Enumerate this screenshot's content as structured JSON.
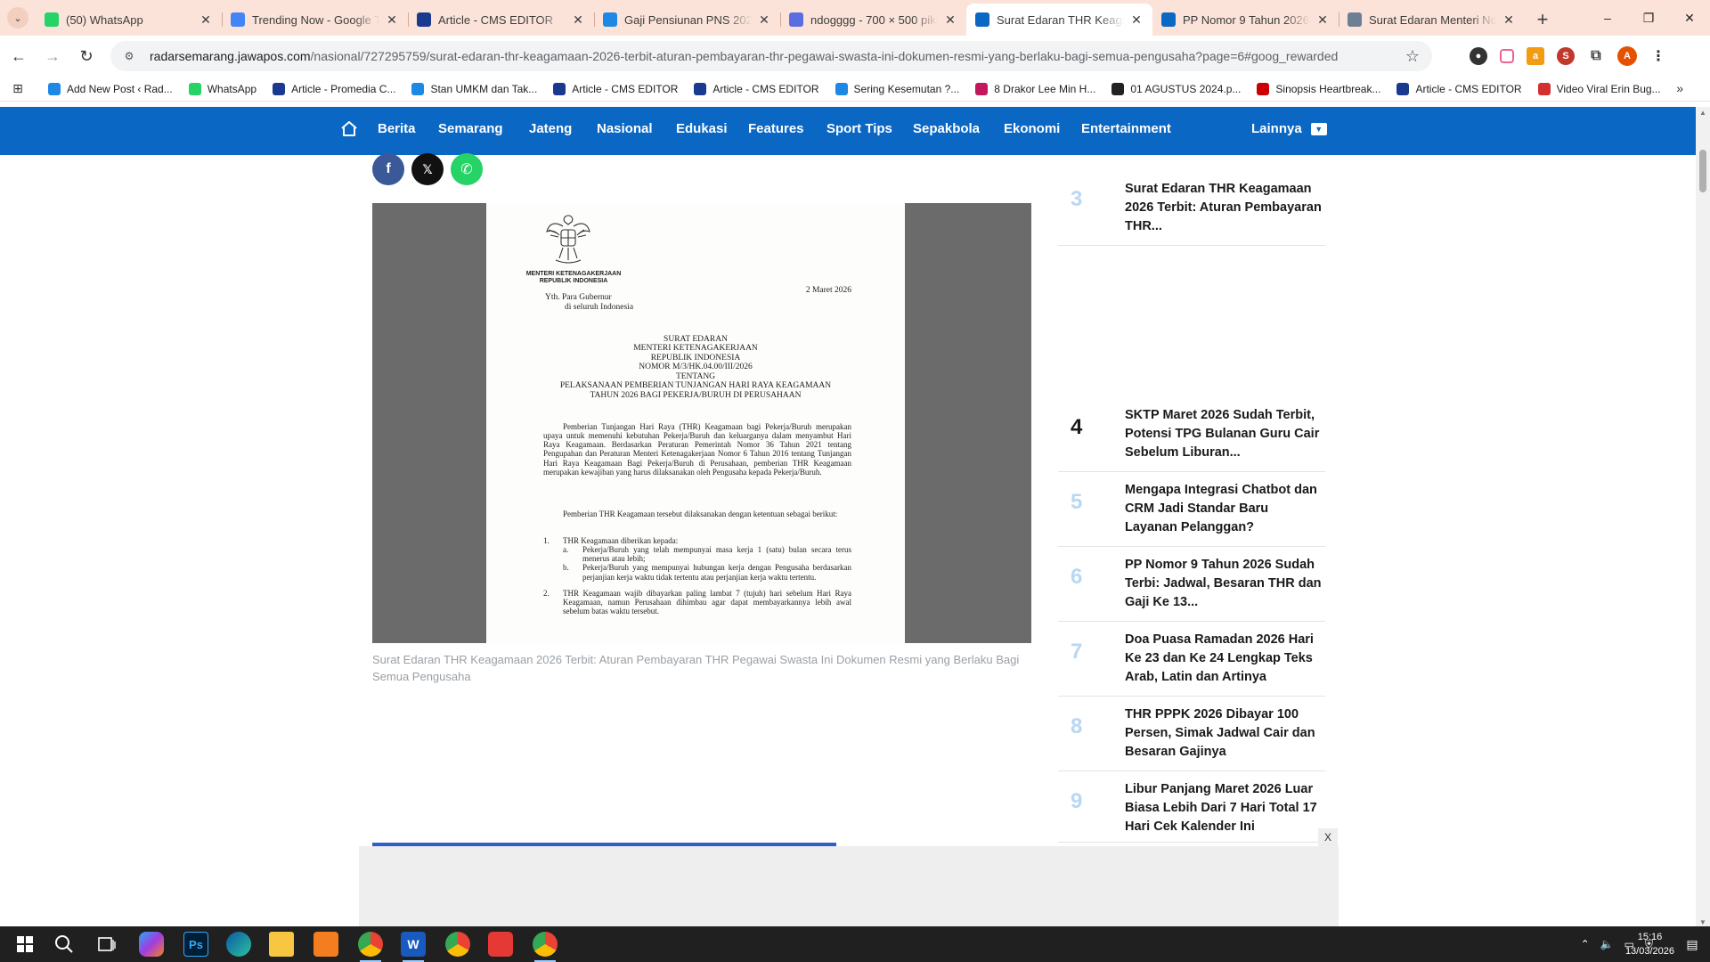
{
  "browser": {
    "tabs": [
      {
        "title": "(50) WhatsApp",
        "favicon": "whatsapp-icon",
        "color": "#25d366",
        "active": false
      },
      {
        "title": "Trending Now - Google Trends",
        "favicon": "google-trends-icon",
        "color": "#4285f4",
        "active": false
      },
      {
        "title": "Article - CMS EDITOR",
        "favicon": "cms-editor-icon",
        "color": "#1a3a8f",
        "active": false
      },
      {
        "title": "Gaji Pensiunan PNS 2026",
        "favicon": "bookmark-doc-icon",
        "color": "#1e88e5",
        "active": false
      },
      {
        "title": "ndogggg - 700 × 500 piksel",
        "favicon": "canva-icon",
        "color": "#5b6ee1",
        "active": false
      },
      {
        "title": "Surat Edaran THR Keagamaan",
        "favicon": "radar-semarang-icon",
        "color": "#0a67c4",
        "active": true
      },
      {
        "title": "PP Nomor 9 Tahun 2026",
        "favicon": "radar-semarang-icon",
        "color": "#0a67c4",
        "active": false
      },
      {
        "title": "Surat Edaran Menteri Nomor",
        "favicon": "generic-site-icon",
        "color": "#6d7f95",
        "active": false
      }
    ],
    "new_tab": "+",
    "window_controls": {
      "minimize": "–",
      "restore": "❐",
      "close": "✕"
    },
    "nav": {
      "back": "←",
      "forward": "→",
      "reload": "↻"
    },
    "url_host": "radarsemarang.jawapos.com",
    "url_path": "/nasional/727295759/surat-edaran-thr-keagamaan-2026-terbit-aturan-pembayaran-thr-pegawai-swasta-ini-dokumen-resmi-yang-berlaku-bagi-semua-pengusaha?page=6#goog_rewarded",
    "star": "☆",
    "profile_initial": "A",
    "bookmarks": [
      {
        "label": "Add New Post ‹ Rad...",
        "icon": "wordpress-doc-icon",
        "color": "#1e88e5"
      },
      {
        "label": "WhatsApp",
        "icon": "whatsapp-icon",
        "color": "#25d366"
      },
      {
        "label": "Article - Promedia C...",
        "icon": "cms-editor-icon",
        "color": "#1a3a8f"
      },
      {
        "label": "Stan UMKM dan Tak...",
        "icon": "bookmark-doc-icon",
        "color": "#1e88e5"
      },
      {
        "label": "Article - CMS EDITOR",
        "icon": "cms-editor-icon",
        "color": "#1a3a8f"
      },
      {
        "label": "Article - CMS EDITOR",
        "icon": "cms-editor-icon",
        "color": "#1a3a8f"
      },
      {
        "label": "Sering Kesemutan ?...",
        "icon": "bookmark-doc-icon",
        "color": "#1e88e5"
      },
      {
        "label": "8 Drakor Lee Min H...",
        "icon": "lu-icon",
        "color": "#c2185b"
      },
      {
        "label": "01 AGUSTUS 2024.p...",
        "icon": "github-icon",
        "color": "#222222"
      },
      {
        "label": "Sinopsis Heartbreak...",
        "icon": "cnn-icon",
        "color": "#cc0000"
      },
      {
        "label": "Article - CMS EDITOR",
        "icon": "cms-editor-icon",
        "color": "#1a3a8f"
      },
      {
        "label": "Video Viral Erin Bug...",
        "icon": "d-doc-icon",
        "color": "#d32f2f"
      }
    ]
  },
  "site_nav": {
    "items": [
      "Berita",
      "Semarang",
      "Jateng",
      "Nasional",
      "Edukasi",
      "Features",
      "Sport Tips",
      "Sepakbola",
      "Ekonomi",
      "Entertainment"
    ],
    "more": "Lainnya"
  },
  "article": {
    "share": [
      {
        "name": "facebook",
        "glyph": "f",
        "color": "#3b5998"
      },
      {
        "name": "x",
        "glyph": "𝕏",
        "color": "#111111"
      },
      {
        "name": "whatsapp",
        "glyph": "✆",
        "color": "#25d366"
      }
    ],
    "document": {
      "ministry": "MENTERI KETENAGAKERJAAN\nREPUBLIK INDONESIA",
      "date": "2 Maret 2026",
      "recipient_1": "Yth. Para Gubernur",
      "recipient_2": "di seluruh Indonesia",
      "heading": [
        "SURAT EDARAN",
        "MENTERI KETENAGAKERJAAN",
        "REPUBLIK INDONESIA",
        "NOMOR M/3/HK.04.00/III/2026",
        "TENTANG",
        "PELAKSANAAN PEMBERIAN TUNJANGAN HARI RAYA KEAGAMAAN",
        "TAHUN 2026 BAGI PEKERJA/BURUH DI PERUSAHAAN"
      ],
      "para_1": "Pemberian Tunjangan Hari Raya (THR) Keagamaan bagi Pekerja/Buruh merupakan upaya untuk memenuhi kebutuhan Pekerja/Buruh dan keluarganya dalam menyambut Hari Raya Keagamaan. Berdasarkan Peraturan Pemerintah Nomor 36 Tahun 2021 tentang Pengupahan dan Peraturan Menteri Ketenagakerjaan Nomor 6 Tahun 2016 tentang Tunjangan Hari Raya Keagamaan Bagi Pekerja/Buruh di Perusahaan, pemberian THR Keagamaan merupakan kewajiban yang harus dilaksanakan oleh Pengusaha kepada Pekerja/Buruh.",
      "para_2": "Pemberian THR Keagamaan tersebut dilaksanakan dengan ketentuan sebagai berikut:",
      "item_1_num": "1.",
      "item_1": "THR Keagamaan diberikan kepada:",
      "item_1a_num": "a.",
      "item_1a": "Pekerja/Buruh yang telah mempunyai masa kerja 1 (satu) bulan secara terus menerus atau lebih;",
      "item_1b_num": "b.",
      "item_1b": "Pekerja/Buruh yang mempunyai hubungan kerja dengan Pengusaha berdasarkan perjanjian kerja waktu tidak tertentu atau perjanjian kerja waktu tertentu.",
      "item_2_num": "2.",
      "item_2": "THR Keagamaan wajib dibayarkan paling lambat 7 (tujuh) hari sebelum Hari Raya Keagamaan, namun Perusahaan dihimbau agar dapat membayarkannya lebih awal sebelum batas waktu tersebut."
    },
    "caption": "Surat Edaran THR Keagamaan 2026 Terbit: Aturan Pembayaran THR Pegawai Swasta Ini Dokumen Resmi yang Berlaku Bagi Semua Pengusaha"
  },
  "sidebar": {
    "items": [
      {
        "num": "3",
        "title": "Surat Edaran THR Keagamaan 2026 Terbit: Aturan Pembayaran THR..."
      },
      {
        "num": "4",
        "title": "SKTP Maret 2026 Sudah Terbit, Potensi TPG Bulanan Guru Cair Sebelum Liburan..."
      },
      {
        "num": "5",
        "title": "Mengapa Integrasi Chatbot dan CRM Jadi Standar Baru Layanan Pelanggan?"
      },
      {
        "num": "6",
        "title": "PP Nomor 9 Tahun 2026 Sudah Terbi: Jadwal, Besaran THR dan Gaji Ke 13..."
      },
      {
        "num": "7",
        "title": "Doa Puasa Ramadan 2026 Hari Ke 23 dan Ke 24 Lengkap Teks Arab, Latin dan Artinya"
      },
      {
        "num": "8",
        "title": "THR PPPK 2026 Dibayar 100 Persen, Simak Jadwal Cair dan Besaran Gajinya"
      },
      {
        "num": "9",
        "title": "Libur Panjang Maret 2026 Luar Biasa Lebih Dari 7 Hari Total 17 Hari Cek Kalender Ini"
      }
    ]
  },
  "ad": {
    "close": "X"
  },
  "taskbar": {
    "apps": [
      "start-icon",
      "search-icon",
      "task-view-icon",
      "copilot-icon",
      "photoshop-icon",
      "edge-icon",
      "file-explorer-icon",
      "app-icon",
      "chrome-profile-icon",
      "word-icon",
      "chrome-icon",
      "wps-icon",
      "chrome-icon-2"
    ],
    "photoshop_label": "Ps",
    "word_label": "W",
    "time": "15:16",
    "date": "13/03/2026"
  },
  "colors": {
    "nav_blue": "#0a67c4",
    "tabstrip": "#fbe3d9",
    "sidebar_num_light": "#b9d7f3"
  }
}
